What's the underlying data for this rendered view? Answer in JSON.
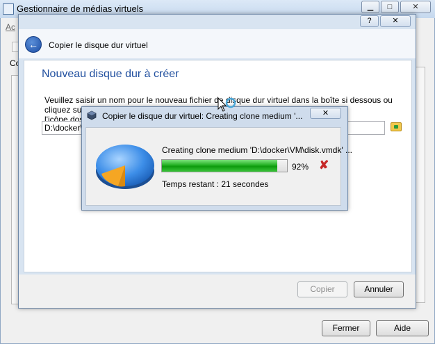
{
  "main_window": {
    "title": "Gestionnaire de médias virtuels",
    "menu_fragment": "Ac",
    "sidebar_fragment": "Co",
    "close_label": "Fermer",
    "help_label": "Aide"
  },
  "copy_dialog": {
    "title": "Copier le disque dur virtuel",
    "section_title": "Nouveau disque dur à créer",
    "instruction_line1": "Veuillez saisir un nom pour le nouveau fichier de disque dur virtuel dans la boîte si dessous ou cliquez sur",
    "instruction_line2": "l'icône dossier",
    "path_value": "D:\\docker\\",
    "copy_button": "Copier",
    "cancel_button": "Annuler",
    "help_icon": "?",
    "close_icon": "✕"
  },
  "progress_dialog": {
    "title": "Copier le disque dur virtuel: Creating clone medium '...",
    "operation_text": "Creating clone medium 'D:\\docker\\VM\\disk.vmdk' ...",
    "progress_percent": 92,
    "percent_label": "92%",
    "time_remaining": "Temps restant : 21 secondes",
    "cancel_icon": "✘",
    "close_icon": "✕"
  },
  "colors": {
    "accent_title": "#1f4e9e",
    "progress_green": "#23b023",
    "cancel_red": "#c62828"
  }
}
